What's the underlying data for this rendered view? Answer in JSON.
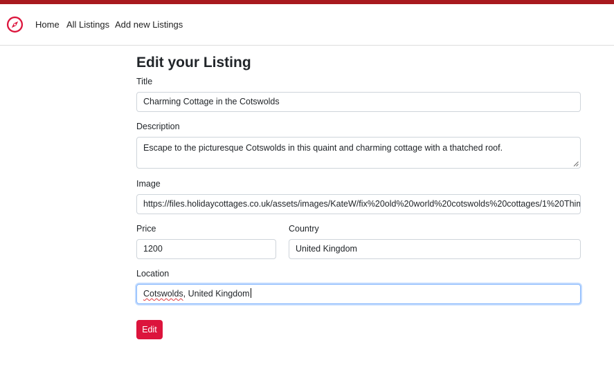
{
  "colors": {
    "top_bar": "#a8191e",
    "brand_icon": "#dc143c",
    "edit_button": "#dc143c",
    "focus_ring": "#86b7fe"
  },
  "navbar": {
    "brand_icon": "compass-icon",
    "links": [
      {
        "label": "Home"
      },
      {
        "label": "All Listings"
      },
      {
        "label": "Add new Listings"
      }
    ]
  },
  "form": {
    "heading": "Edit your Listing",
    "title": {
      "label": "Title",
      "value": "Charming Cottage in the Cotswolds"
    },
    "description": {
      "label": "Description",
      "value": "Escape to the picturesque Cotswolds in this quaint and charming cottage with a thatched roof."
    },
    "image": {
      "label": "Image",
      "value": "https://files.holidaycottages.co.uk/assets/images/KateW/fix%20old%20world%20cotswolds%20cottages/1%20Thim"
    },
    "price": {
      "label": "Price",
      "value": "1200"
    },
    "country": {
      "label": "Country",
      "value": "United Kingdom"
    },
    "location": {
      "label": "Location",
      "value_misspelled": "Cotswolds",
      "value_rest": ", United Kingdom"
    },
    "submit_label": "Edit"
  }
}
